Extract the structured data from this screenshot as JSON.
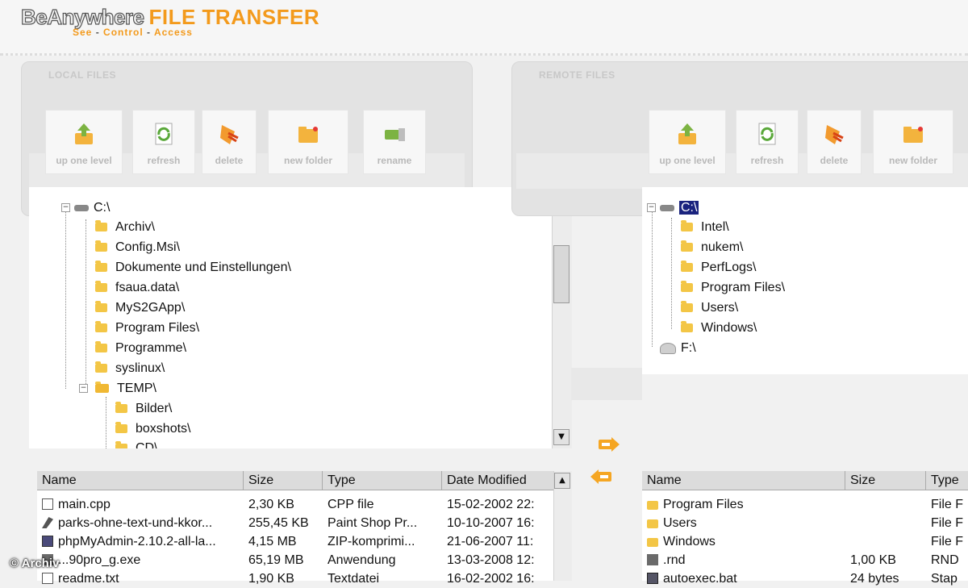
{
  "app": {
    "brand_main": "BeAnywhere",
    "brand_accent": "FILE TRANSFER",
    "tagline_see": "See",
    "tagline_control": "Control",
    "tagline_access": "Access",
    "tagline_sep": "-"
  },
  "local": {
    "title": "LOCAL FILES",
    "toolbar": [
      {
        "label": "up one level",
        "icon": "up-level-icon"
      },
      {
        "label": "refresh",
        "icon": "refresh-icon"
      },
      {
        "label": "delete",
        "icon": "delete-icon"
      },
      {
        "label": "new folder",
        "icon": "new-folder-icon"
      },
      {
        "label": "rename",
        "icon": "rename-icon"
      }
    ],
    "tree_root": "C:\\",
    "tree": [
      "Archiv\\",
      "Config.Msi\\",
      "Dokumente und Einstellungen\\",
      "fsaua.data\\",
      "MyS2GApp\\",
      "Program Files\\",
      "Programme\\",
      "syslinux\\",
      "TEMP\\"
    ],
    "tree_sub": [
      "Bilder\\",
      "boxshots\\",
      "CD\\"
    ],
    "columns": [
      "Name",
      "Size",
      "Type",
      "Date Modified"
    ],
    "rows": [
      {
        "name": "main.cpp",
        "size": "2,30 KB",
        "type": "CPP file",
        "date": "15-02-2002 22:",
        "icon": "cpp-file-icon"
      },
      {
        "name": "parks-ohne-text-und-kkor...",
        "size": "255,45 KB",
        "type": "Paint Shop Pr...",
        "date": "10-10-2007 16:",
        "icon": "image-file-icon"
      },
      {
        "name": "phpMyAdmin-2.10.2-all-la...",
        "size": "4,15 MB",
        "type": "ZIP-komprimi...",
        "date": "21-06-2007 11:",
        "icon": "zip-file-icon"
      },
      {
        "name": "...90pro_g.exe",
        "size": "65,19 MB",
        "type": "Anwendung",
        "date": "13-03-2008 12:",
        "icon": "exe-file-icon"
      },
      {
        "name": "readme.txt",
        "size": "1,90 KB",
        "type": "Textdatei",
        "date": "16-02-2002 16:",
        "icon": "text-file-icon"
      }
    ]
  },
  "remote": {
    "title": "REMOTE FILES",
    "toolbar": [
      {
        "label": "up one level",
        "icon": "up-level-icon"
      },
      {
        "label": "refresh",
        "icon": "refresh-icon"
      },
      {
        "label": "delete",
        "icon": "delete-icon"
      },
      {
        "label": "new folder",
        "icon": "new-folder-icon"
      }
    ],
    "tree_root": "C:\\",
    "tree": [
      "Intel\\",
      "nukem\\",
      "PerfLogs\\",
      "Program Files\\",
      "Users\\",
      "Windows\\"
    ],
    "drive2": "F:\\",
    "columns": [
      "Name",
      "Size",
      "Type"
    ],
    "rows": [
      {
        "name": "Program Files",
        "size": "",
        "type": "File F",
        "icon": "folder-icon"
      },
      {
        "name": "Users",
        "size": "",
        "type": "File F",
        "icon": "folder-icon"
      },
      {
        "name": "Windows",
        "size": "",
        "type": "File F",
        "icon": "folder-icon"
      },
      {
        "name": ".rnd",
        "size": "1,00 KB",
        "type": "RND",
        "icon": "generic-file-icon"
      },
      {
        "name": "autoexec.bat",
        "size": "24 bytes",
        "type": "Stap",
        "icon": "batch-file-icon"
      }
    ]
  },
  "watermark": "© Archiv",
  "colors": {
    "accent": "#f39a1c",
    "selection": "#1a237e",
    "folder": "#f3c646"
  }
}
